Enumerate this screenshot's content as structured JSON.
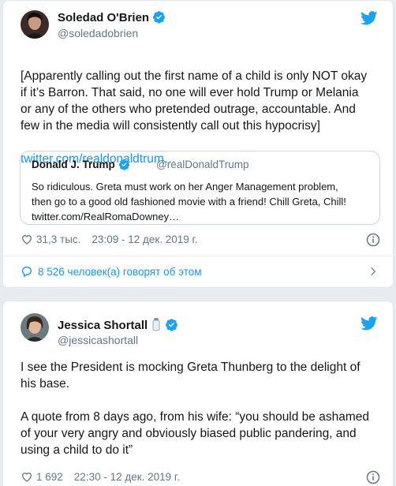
{
  "tweet1": {
    "name": "Soledad O'Brien",
    "handle": "@soledadobrien",
    "text": "[Apparently calling out the first name of a child is only NOT okay\nif it’s Barron. That said, no one will ever hold Trump or Melania\nor any of the others who pretended outrage, accountable. And\nfew in the media will consistently call out this hypocrisy]",
    "link": "twitter.com/realdonaldtrum…",
    "quote": {
      "name": "Donald J. Trump",
      "handle": "@realDonaldTrump",
      "text": "So ridiculous. Greta must work on her Anger Management problem,\nthen go to a good old fashioned movie with a friend! Chill Greta, Chill!\ntwitter.com/RealRomaDowney…"
    },
    "likes": "31,3 тыс.",
    "timestamp": "23:09 - 12 дек. 2019 г.",
    "conversation": "8 526 человек(а) говорят об этом"
  },
  "tweet2": {
    "name": "Jessica Shortall",
    "handle": "@jessicashortall",
    "text": "I see the President is mocking Greta Thunberg to the delight of\nhis base.\n\nA quote from 8 days ago, from his wife: “you should be ashamed\nof your very angry and obviously biased public pandering, and\nusing a child to do it”",
    "likes": "1 692",
    "timestamp": "22:30 - 12 дек. 2019 г."
  },
  "colors": {
    "twitter_blue": "#1da1f2",
    "link_blue": "#1b95e0",
    "muted": "#657786",
    "text": "#14171a"
  }
}
